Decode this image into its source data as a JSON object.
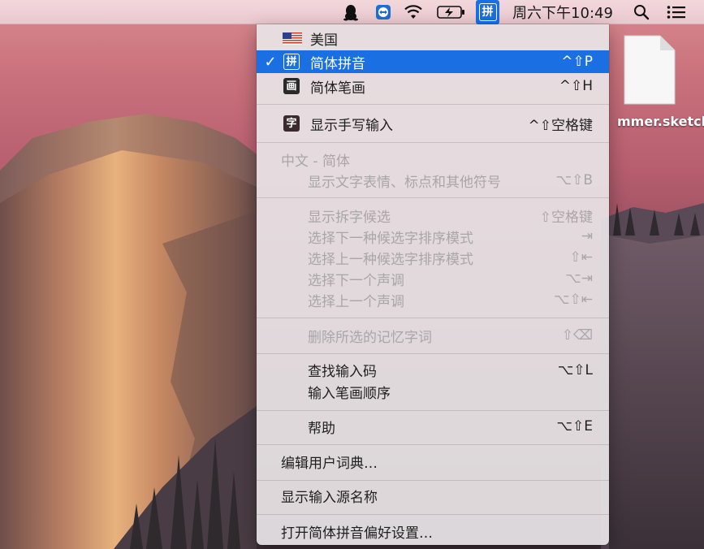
{
  "menubar": {
    "icons": [
      {
        "name": "qq-penguin-icon"
      },
      {
        "name": "teamviewer-icon"
      },
      {
        "name": "wifi-icon"
      },
      {
        "name": "battery-charging-icon"
      },
      {
        "name": "input-method-icon",
        "glyph": "拼"
      },
      {
        "name": "spotlight-search-icon"
      },
      {
        "name": "notification-center-icon"
      }
    ],
    "clock": "周六下午10:49"
  },
  "desktop": {
    "file_label": "mmer.sketch"
  },
  "menu": {
    "input_sources": [
      {
        "label": "美国",
        "icon": "us-flag-icon"
      },
      {
        "label": "简体拼音",
        "icon_glyph": "拼",
        "shortcut": "^⇧P",
        "checked": "✓",
        "selected": true
      },
      {
        "label": "简体笔画",
        "icon_glyph": "画",
        "shortcut": "^⇧H"
      }
    ],
    "handwriting": {
      "label": "显示手写输入",
      "icon_glyph": "字",
      "shortcut": "^⇧空格键"
    },
    "section_header": "中文 - 简体",
    "emoji": {
      "label": "显示文字表情、标点和其他符号",
      "shortcut": "⌥⇧B"
    },
    "candidate_options": [
      {
        "label": "显示拆字候选",
        "shortcut": "⇧空格键"
      },
      {
        "label": "选择下一种候选字排序模式",
        "shortcut": "⇥"
      },
      {
        "label": "选择上一种候选字排序模式",
        "shortcut": "⇧⇤"
      },
      {
        "label": "选择下一个声调",
        "shortcut": "⌥⇥"
      },
      {
        "label": "选择上一个声调",
        "shortcut": "⌥⇧⇤"
      }
    ],
    "delete_memory": {
      "label": "删除所选的记忆字词",
      "shortcut": "⇧⌫"
    },
    "lookup": {
      "label": "查找输入码",
      "shortcut": "⌥⇧L"
    },
    "stroke_order": {
      "label": "输入笔画顺序"
    },
    "help": {
      "label": "帮助",
      "shortcut": "⌥⇧E"
    },
    "edit_dictionary": {
      "label": "编辑用户词典…"
    },
    "show_source_name": {
      "label": "显示输入源名称"
    },
    "open_preferences": {
      "label": "打开简体拼音偏好设置…"
    }
  },
  "colors": {
    "selection": "#1a6fe3",
    "disabled_text": "#a9a6a8"
  }
}
